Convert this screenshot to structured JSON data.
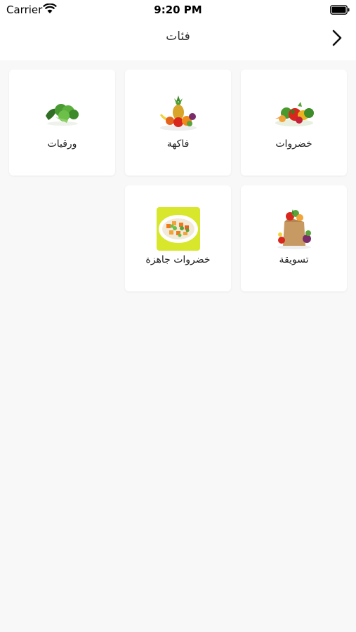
{
  "status_bar": {
    "carrier": "Carrier",
    "time": "9:20 PM"
  },
  "nav": {
    "title": "فئات",
    "back_icon": "chevron-right-icon"
  },
  "categories": [
    {
      "label": "خضروات",
      "icon": "vegetables-image"
    },
    {
      "label": "فاكهة",
      "icon": "fruits-image"
    },
    {
      "label": "ورقيات",
      "icon": "leafy-greens-image"
    },
    {
      "label": "تسويقة",
      "icon": "grocery-bag-image"
    },
    {
      "label": "خضروات جاهزة",
      "icon": "ready-vegetables-image"
    }
  ],
  "colors": {
    "background": "#f8f8f8",
    "card": "#ffffff",
    "ready_veg_tile": "#d8e72b"
  }
}
